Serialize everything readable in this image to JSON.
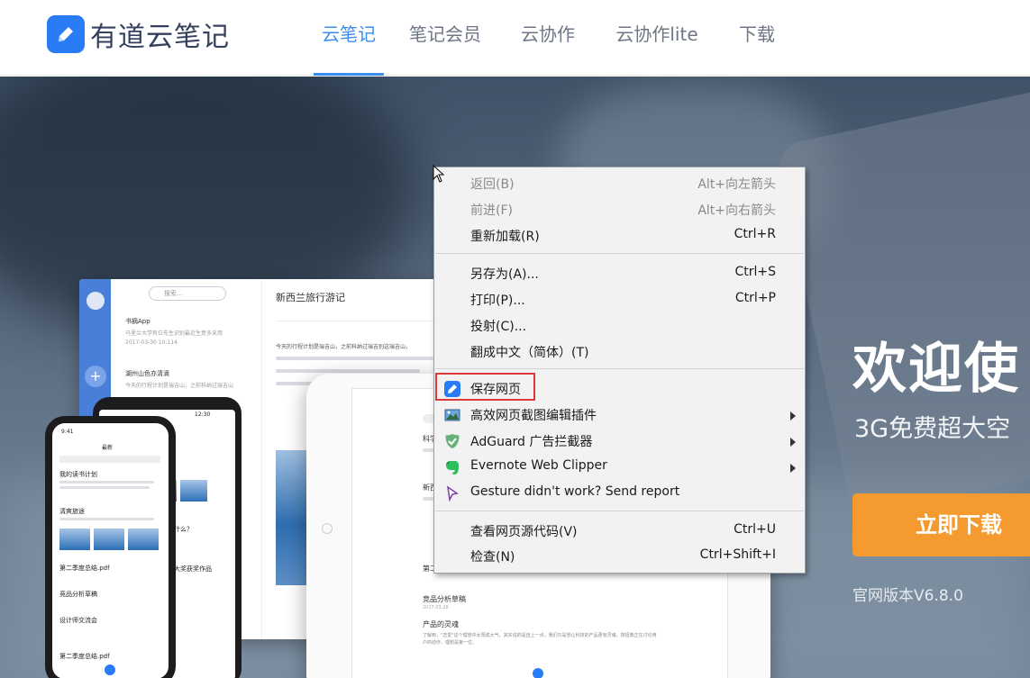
{
  "header": {
    "logo_text": "有道云笔记",
    "nav": [
      {
        "label": "云笔记",
        "active": true
      },
      {
        "label": "笔记会员",
        "active": false
      },
      {
        "label": "云协作",
        "active": false
      },
      {
        "label": "云协作lite",
        "active": false
      },
      {
        "label": "下载",
        "active": false
      }
    ]
  },
  "hero": {
    "welcome": "欢迎使",
    "subtitle": "3G免费超大空",
    "download_button": "立即下载",
    "version": "官网版本V6.8.0",
    "colors": {
      "accent": "#3b8ef0",
      "download": "#f59a2e"
    },
    "desktop_mock": {
      "search": "搜索...",
      "note_title": "新西兰旅行游记",
      "notes": [
        {
          "title": "书摘App",
          "sub": "马里兰大学有位先生识别最近生意多采用",
          "date": "2017-03-30   10:114"
        },
        {
          "title": "湖州山色亦清滴",
          "sub": "今天的行程计划是瑞吉山，之前科纳过瑞吉山",
          "date": ""
        }
      ],
      "body_start": "今天的行程计划是瑞吉山，之前科纳过瑞吉别这瑞吉山，"
    },
    "phone_mock": {
      "time": "9:41",
      "time2": "12:30",
      "tab": "最新",
      "items": [
        "我的读书计划",
        "清爽旅途",
        "第二季度总结.pdf",
        "竞品分析草稿",
        "设计师交流会",
        "第二季度总结.pdf"
      ],
      "side_items": [
        "做什么？",
        "计大奖获奖作品"
      ]
    },
    "tablet_mock": {
      "items": [
        "科学",
        "新西",
        "第二",
        "竞品分析草稿",
        "产品的灵魂"
      ],
      "date": "2017.03.28",
      "body": "了解到，\"恋爱\"这个理想中太阳成大气，其实说的是自上一点，我们只是想让科技的产品更有灵魂，按钮典正在讨论用户的动作，理想是第一位。"
    }
  },
  "context_menu": {
    "items": [
      {
        "label": "返回(B)",
        "shortcut": "Alt+向左箭头",
        "disabled": true
      },
      {
        "label": "前进(F)",
        "shortcut": "Alt+向右箭头",
        "disabled": true
      },
      {
        "label": "重新加载(R)",
        "shortcut": "Ctrl+R",
        "disabled": false
      },
      {
        "label": "另存为(A)...",
        "shortcut": "Ctrl+S",
        "disabled": false
      },
      {
        "label": "打印(P)...",
        "shortcut": "Ctrl+P",
        "disabled": false
      },
      {
        "label": "投射(C)...",
        "shortcut": "",
        "disabled": false
      },
      {
        "label": "翻成中文（简体）(T)",
        "shortcut": "",
        "disabled": false
      },
      {
        "label": "保存网页",
        "shortcut": "",
        "disabled": false,
        "icon": "youdao-note-icon",
        "highlighted": true
      },
      {
        "label": "高效网页截图编辑插件",
        "shortcut": "",
        "disabled": false,
        "icon": "screenshot-icon",
        "submenu": true
      },
      {
        "label": "AdGuard 广告拦截器",
        "shortcut": "",
        "disabled": false,
        "icon": "adguard-shield-icon",
        "submenu": true
      },
      {
        "label": "Evernote Web Clipper",
        "shortcut": "",
        "disabled": false,
        "icon": "evernote-icon",
        "submenu": true
      },
      {
        "label": "Gesture didn't work? Send report",
        "shortcut": "",
        "disabled": false,
        "icon": "gesture-icon"
      },
      {
        "label": "查看网页源代码(V)",
        "shortcut": "Ctrl+U",
        "disabled": false
      },
      {
        "label": "检查(N)",
        "shortcut": "Ctrl+Shift+I",
        "disabled": false
      }
    ]
  }
}
